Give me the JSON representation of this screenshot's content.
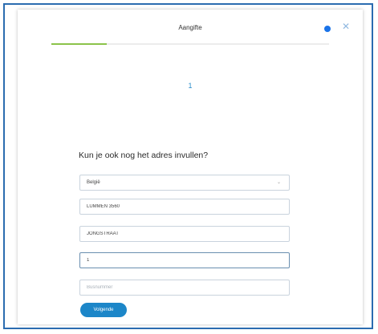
{
  "dialog": {
    "title": "Aangifte",
    "close_glyph": "✕",
    "progress_fraction": 0.2,
    "step_number": "1"
  },
  "form": {
    "question": "Kun je ook nog het adres invullen?",
    "country": {
      "value": "België",
      "chevron_glyph": "⌄"
    },
    "city": {
      "value": "LUMMEN 3560"
    },
    "street": {
      "value": "JONGSTRAAT"
    },
    "house_number": {
      "value": "1"
    },
    "box_number": {
      "placeholder": "Busnummer"
    },
    "next_label": "Volgende"
  },
  "colors": {
    "accent": "#1c86c8",
    "progress": "#8bc34a",
    "frame_border": "#2b6cb0"
  },
  "icons": {
    "help": "help-icon",
    "close": "close-icon",
    "dropdown": "chevron-down-icon"
  }
}
